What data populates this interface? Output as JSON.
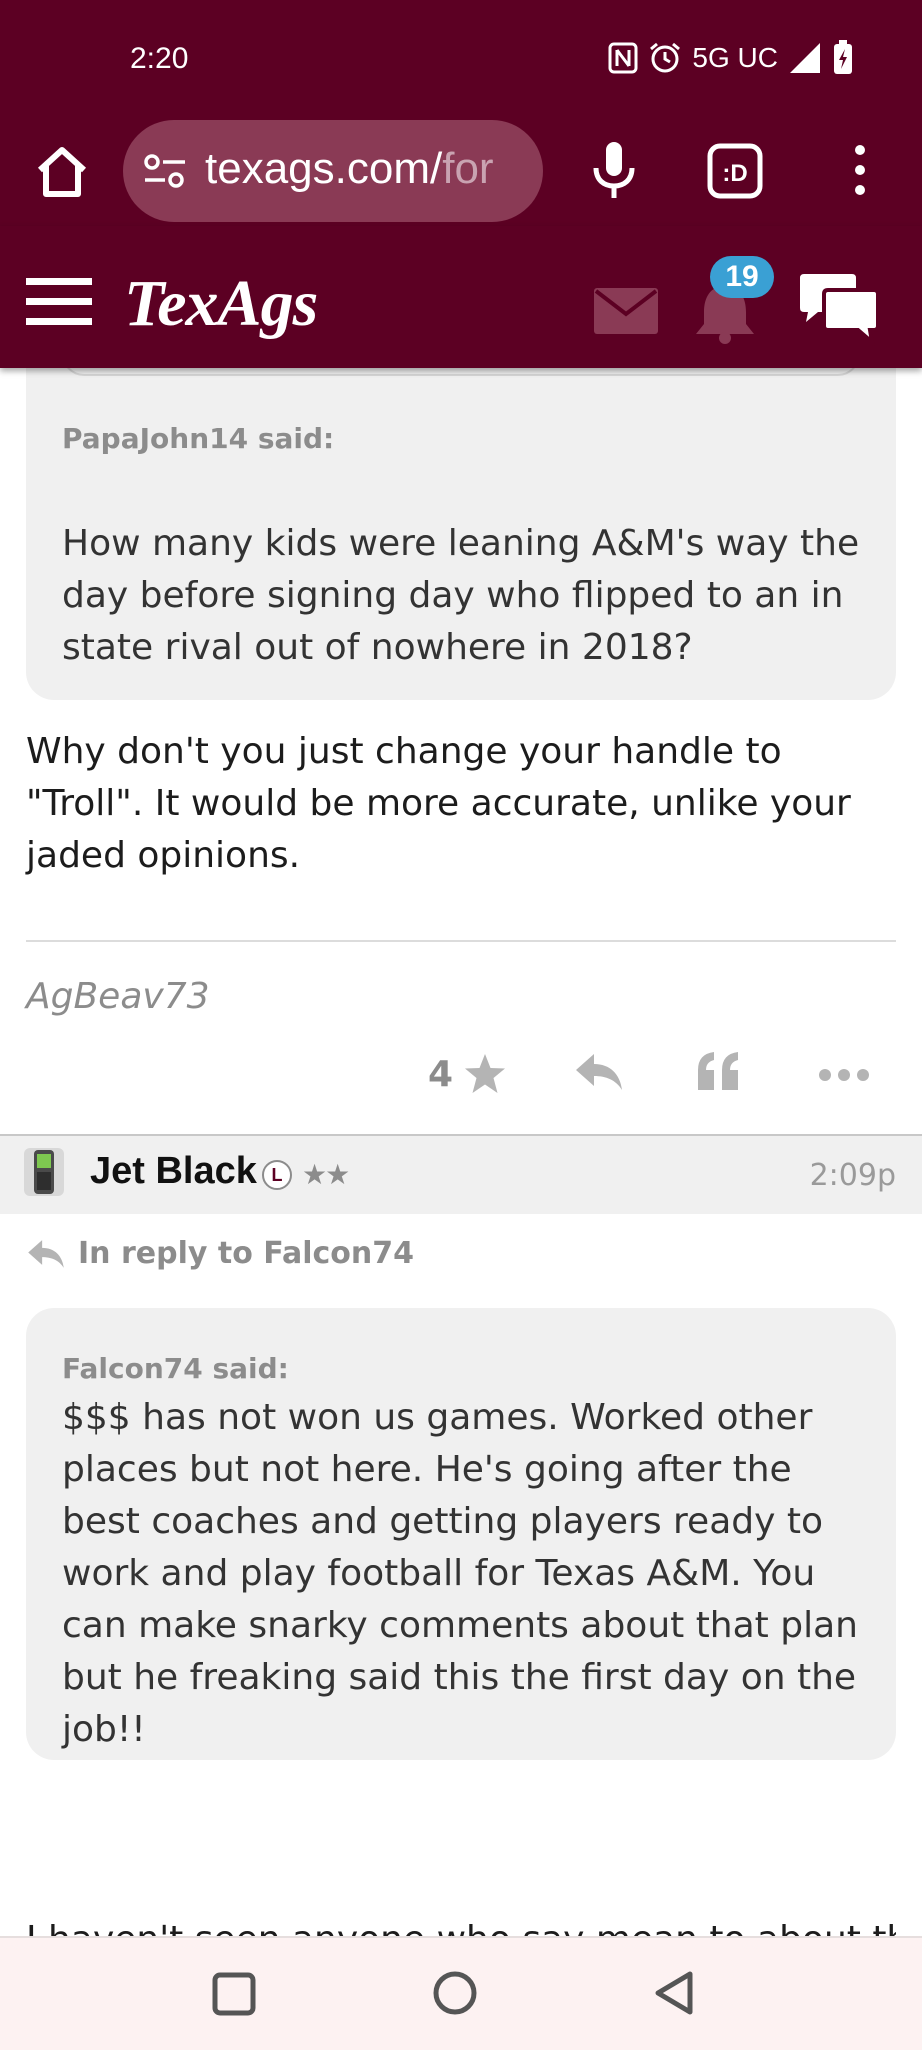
{
  "status_bar": {
    "time": "2:20",
    "network": "5G UC",
    "icons": [
      "nfc-icon",
      "alarm-icon",
      "data-arrows-icon",
      "signal-icon",
      "battery-charging-icon"
    ]
  },
  "browser": {
    "url_main": "texags.com/",
    "url_rest": "for",
    "tab_count": ":D",
    "icons": [
      "home-icon",
      "site-settings-icon",
      "mic-icon",
      "tabs-icon",
      "more-vert-icon"
    ]
  },
  "site": {
    "logo": "TexAgs",
    "notification_count": "19",
    "icons": [
      "hamburger-icon",
      "mail-icon",
      "bell-icon",
      "chat-icon"
    ]
  },
  "post1": {
    "quote_author": "PapaJohn14 said:",
    "quote_text": "How many kids were leaning A&M's way the day before signing day who flipped to an in state rival out of nowhere in 2018?",
    "body": "Why don't you just change your handle to \"Troll\". It would be more accurate, unlike your jaded opinions.",
    "signature": "AgBeav73",
    "rating": "4"
  },
  "post2": {
    "username": "Jet Black",
    "badge": "L",
    "stars": "★★",
    "time": "2:09p",
    "reply_to": "In reply to Falcon74",
    "quote_author": "Falcon74 said:",
    "quote_text": "$$$ has not won us games. Worked other places but not here. He's going after the best coaches and getting players ready to work and play football for Texas A&M. You can make snarky comments about that plan but he freaking said this the first day on the job!!",
    "partial_text": "I haven't seen anyone who say mean to about that"
  },
  "colors": {
    "maroon": "#5c0023",
    "badge_blue": "#3aa0d4",
    "quote_bg": "#f0f0f0",
    "muted": "#8c8c8c"
  }
}
